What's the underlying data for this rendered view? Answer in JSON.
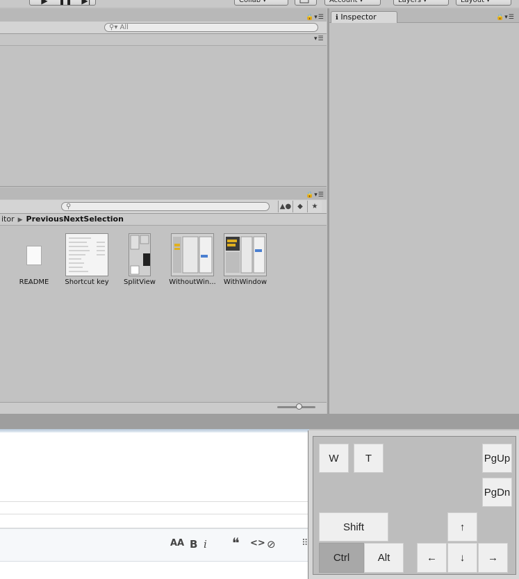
{
  "toolbar": {
    "play_icons": [
      "▶",
      "❚❚",
      "▶|"
    ],
    "collab_label": "Collab ▾",
    "cloud_icon": "cloud-icon",
    "account_label": "Account ▾",
    "layers_label": "Layers ▾",
    "layout_label": "Layout ▾"
  },
  "hierarchy": {
    "search_placeholder": "All",
    "panel_menu": "▾☰"
  },
  "inspector": {
    "tab_label": "Inspector",
    "info_icon": "ℹ",
    "panel_menu": "🔒▾☰"
  },
  "project": {
    "breadcrumb": [
      "itor",
      "PreviousNextSelection"
    ],
    "assets": [
      {
        "label": "..."
      },
      {
        "label": "README"
      },
      {
        "label": "Shortcut key"
      },
      {
        "label": "SplitView"
      },
      {
        "label": "WithoutWin..."
      },
      {
        "label": "WithWindow"
      }
    ]
  },
  "editor": {
    "tools": [
      "AA",
      "B",
      "i",
      "❝",
      "<>",
      "⊘"
    ]
  },
  "keyboard": {
    "keys": {
      "w": "W",
      "t": "T",
      "pgup": "PgUp",
      "pgdn": "PgDn",
      "shift": "Shift",
      "up": "↑",
      "ctrl": "Ctrl",
      "alt": "Alt",
      "left": "←",
      "down": "↓",
      "right": "→"
    },
    "pressed": [
      "ctrl"
    ]
  },
  "colors": {
    "panel": "#c2c2c2",
    "key": "#efefef",
    "key_pressed": "#a8a8a8"
  }
}
